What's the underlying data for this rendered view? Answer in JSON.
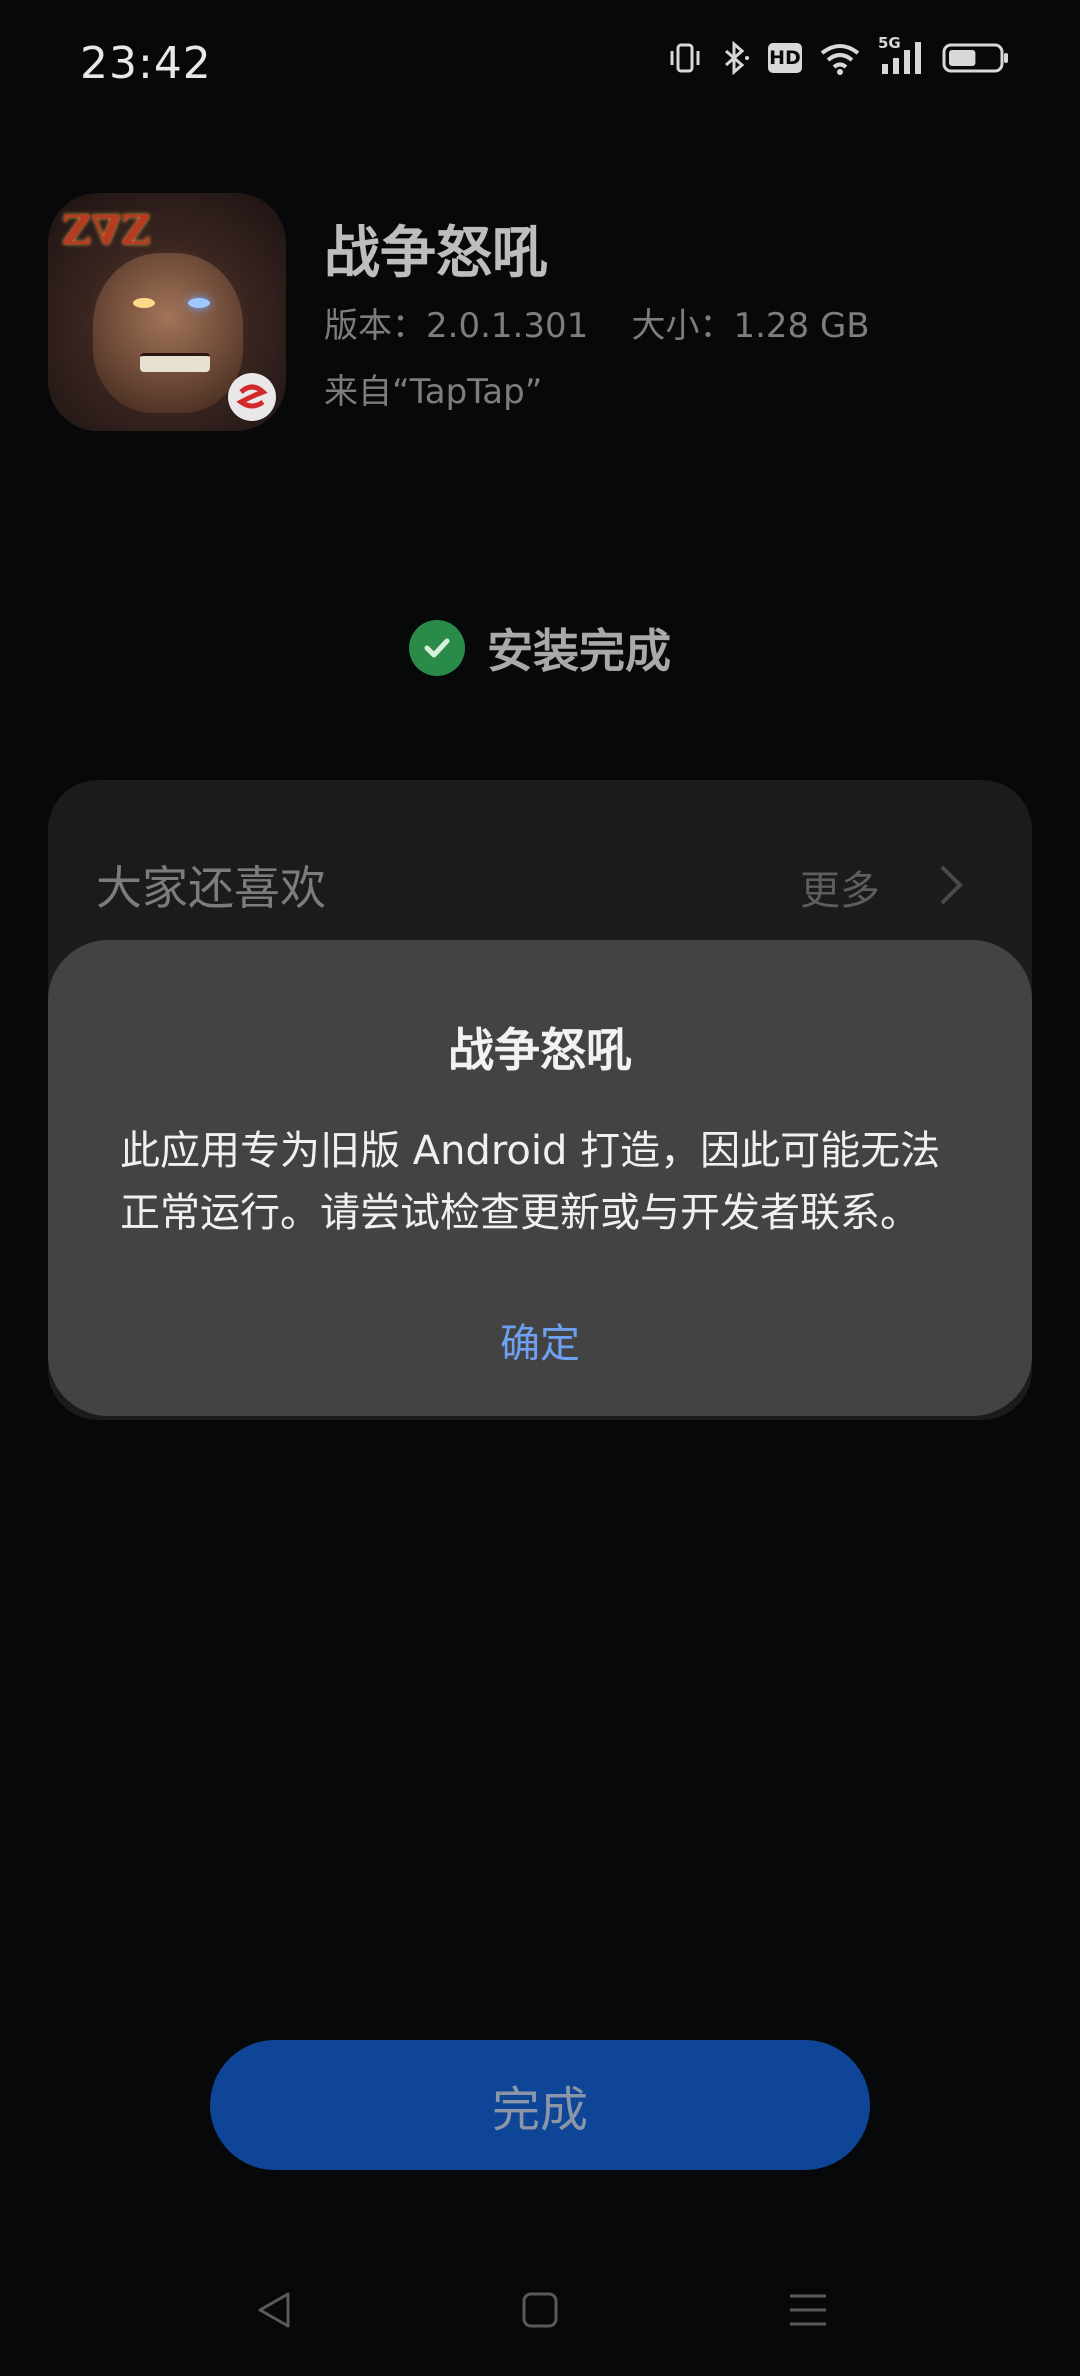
{
  "status_bar": {
    "time": "23:42",
    "hd_label": "HD",
    "network_label": "5G",
    "icons": [
      "vibrate-icon",
      "bluetooth-icon",
      "hd-icon",
      "wifi-icon",
      "signal-5g-icon",
      "battery-icon"
    ],
    "battery_level": 0.55
  },
  "app": {
    "name": "战争怒吼",
    "meta": "版本：2.0.1.301    大小：1.28 GB",
    "source": "来自“TapTap”",
    "icon_logo_text": "Z∇Z"
  },
  "install": {
    "status_text": "安装完成",
    "status_color": "#2a8a48"
  },
  "recommend": {
    "title": "大家还喜欢",
    "more_label": "更多"
  },
  "dialog": {
    "title": "战争怒吼",
    "message": "此应用专为旧版 Android 打造，因此可能无法正常运行。请尝试检查更新或与开发者联系。",
    "ok_label": "确定",
    "ok_color": "#6f9ff0"
  },
  "done_button": {
    "label": "完成",
    "color": "#0e4596"
  },
  "nav": {
    "icons": [
      "back-icon",
      "home-icon",
      "menu-icon"
    ]
  }
}
